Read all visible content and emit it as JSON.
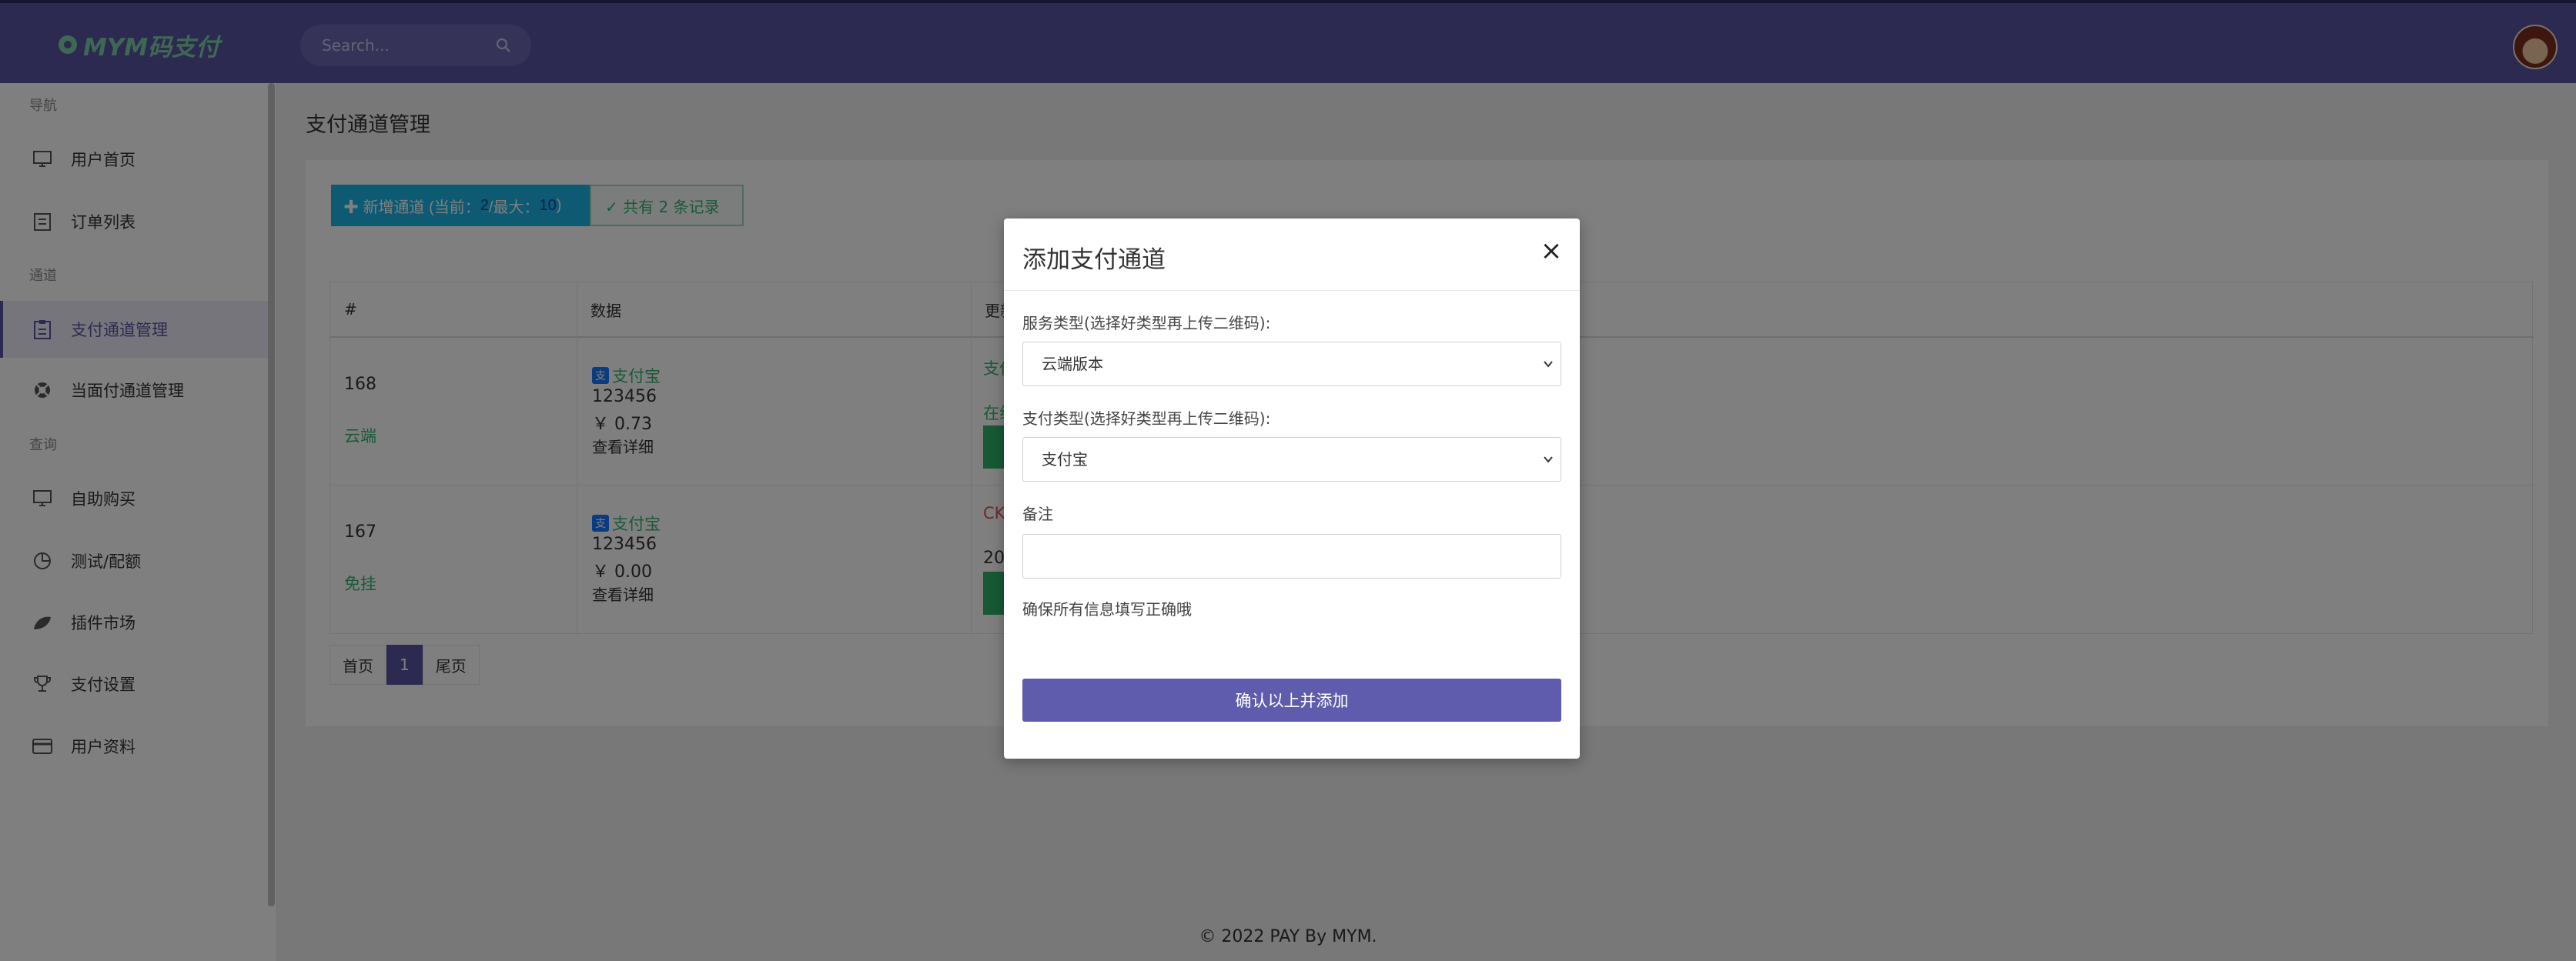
{
  "app": {
    "logo_text": "MYM码支付",
    "search_placeholder": "Search..."
  },
  "sidebar": {
    "sections": [
      "导航",
      "通道",
      "查询"
    ],
    "items": [
      {
        "label": "用户首页",
        "icon": "monitor-icon"
      },
      {
        "label": "订单列表",
        "icon": "list-icon"
      },
      {
        "label": "支付通道管理",
        "icon": "clipboard-icon",
        "active": true
      },
      {
        "label": "当面付通道管理",
        "icon": "lifebuoy-icon"
      },
      {
        "label": "自助购买",
        "icon": "monitor-icon"
      },
      {
        "label": "测试/配额",
        "icon": "pie-icon"
      },
      {
        "label": "插件市场",
        "icon": "leaf-icon"
      },
      {
        "label": "支付设置",
        "icon": "trophy-icon"
      },
      {
        "label": "用户资料",
        "icon": "card-icon"
      }
    ]
  },
  "page": {
    "title": "支付通道管理",
    "add_button": {
      "prefix": "✚ 新增通道 (当前：",
      "current": "2",
      "middle": "/最大：",
      "max": "10",
      "suffix": ")"
    },
    "total_badge": "✓ 共有 2 条记录"
  },
  "table": {
    "headers": [
      "#",
      "数据",
      "更新"
    ],
    "rows": [
      {
        "id": "168",
        "tag": "云端",
        "pay_name": "支付宝",
        "account": "123456",
        "amount": "￥ 0.73",
        "detail": "查看详细",
        "status_a": "支付",
        "status_b": "在线"
      },
      {
        "id": "167",
        "tag": "免挂",
        "pay_name": "支付宝",
        "account": "123456",
        "amount": "￥ 0.00",
        "detail": "查看详细",
        "status_a": "CK",
        "status_b": "20"
      }
    ]
  },
  "pager": {
    "first": "首页",
    "current": "1",
    "last": "尾页"
  },
  "footer": "© 2022 PAY By MYM.",
  "modal": {
    "title": "添加支付通道",
    "close": "×",
    "service_label": "服务类型(选择好类型再上传二维码):",
    "service_value": "云端版本",
    "pay_label": "支付类型(选择好类型再上传二维码):",
    "pay_value": "支付宝",
    "remark_label": "备注",
    "remark_value": "",
    "hint": "确保所有信息填写正确哦",
    "submit": "确认以上并添加"
  }
}
